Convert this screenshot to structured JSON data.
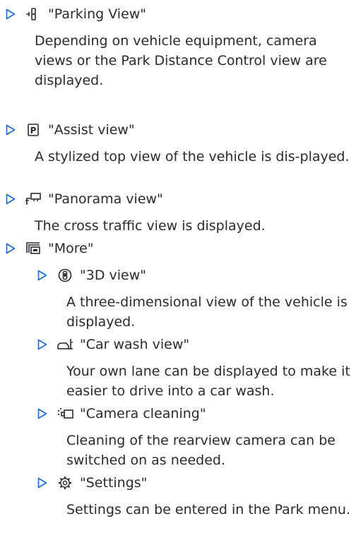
{
  "items": [
    {
      "icon": "parking-sensor-icon",
      "label": "\"Parking View\"",
      "description": "Depending on vehicle equipment, camera views or the Park Distance Control view are displayed."
    },
    {
      "icon": "park-p-icon",
      "label": "\"Assist view\"",
      "description": "A stylized top view of the vehicle is dis-played."
    },
    {
      "icon": "panorama-icon",
      "label": "\"Panorama view\"",
      "description": "The cross traffic view is displayed."
    },
    {
      "icon": "more-windows-icon",
      "label": "\"More\"",
      "description": ""
    }
  ],
  "subitems": [
    {
      "icon": "3d-view-icon",
      "label": "\"3D view\"",
      "description": "A three-dimensional view of the vehicle is displayed."
    },
    {
      "icon": "car-wash-icon",
      "label": "\"Car wash view\"",
      "description": "Your own lane can be displayed to make it easier to drive into a car wash."
    },
    {
      "icon": "camera-cleaning-icon",
      "label": "\"Camera cleaning\"",
      "description": "Cleaning of the rearview camera can be switched on as needed."
    },
    {
      "icon": "settings-gear-icon",
      "label": "\"Settings\"",
      "description": "Settings can be entered in the Park menu."
    }
  ],
  "colors": {
    "text": "#2b2b2b",
    "triangle": "#1c69d4"
  }
}
